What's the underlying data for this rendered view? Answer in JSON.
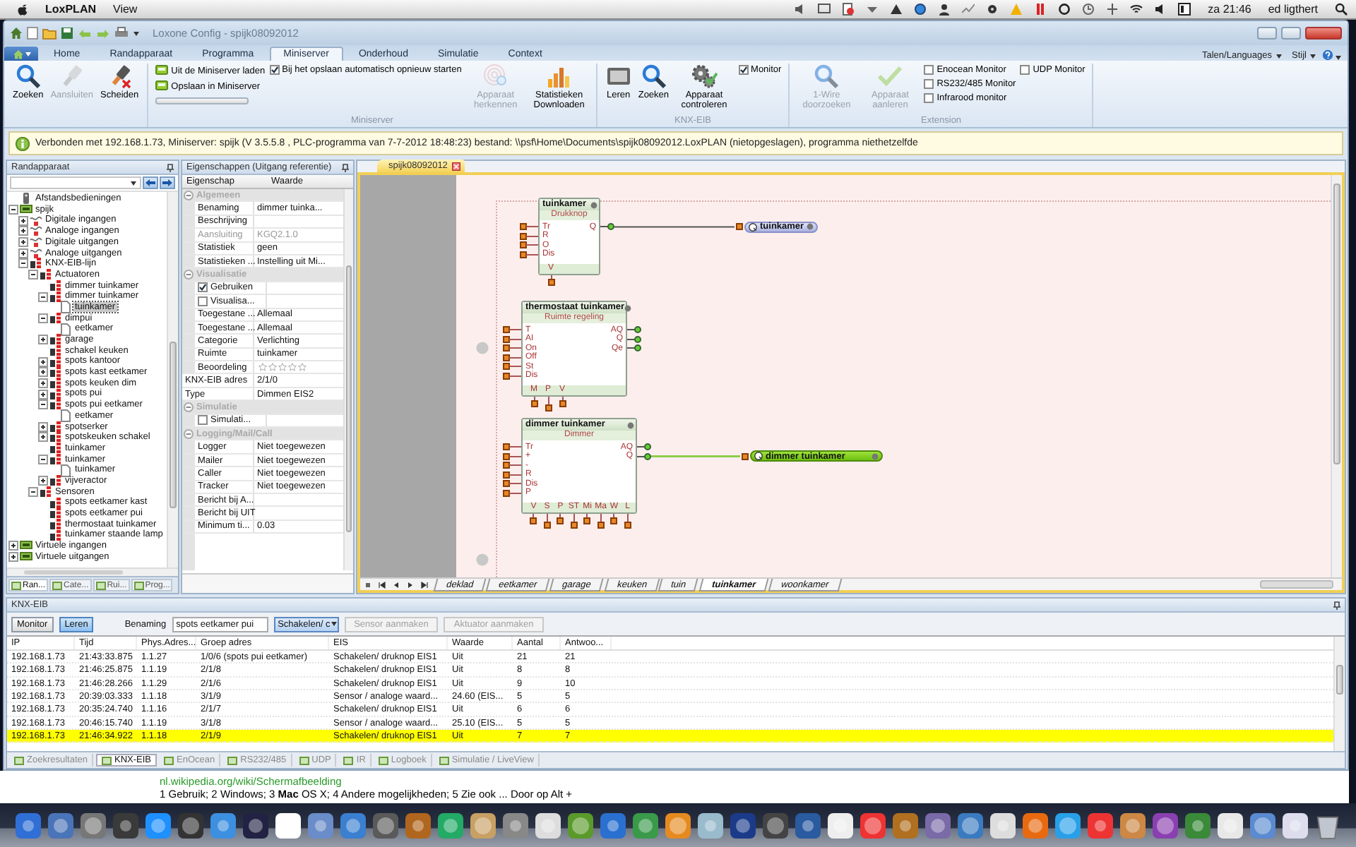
{
  "menubar": {
    "app": "LoxPLAN",
    "menus": [
      "View"
    ],
    "clock": "za 21:46",
    "user": "ed ligthert"
  },
  "window": {
    "title": "Loxone Config - spijk08092012"
  },
  "ribbon_tabs": [
    {
      "label": "Home",
      "selected": false
    },
    {
      "label": "Randapparaat",
      "selected": false
    },
    {
      "label": "Programma",
      "selected": false
    },
    {
      "label": "Miniserver",
      "selected": true
    },
    {
      "label": "Onderhoud",
      "selected": false
    },
    {
      "label": "Simulatie",
      "selected": false
    },
    {
      "label": "Context",
      "selected": false
    }
  ],
  "ribbon_links": [
    "Talen/Languages",
    "Stijl"
  ],
  "ribbon_groups": [
    {
      "items": [
        {
          "kind": "big",
          "label": "Zoeken",
          "disabled": false
        },
        {
          "kind": "big",
          "label": "Aansluiten",
          "disabled": true
        },
        {
          "kind": "big",
          "label": "Scheiden",
          "disabled": false
        }
      ]
    },
    {
      "label": "Miniserver",
      "items": [
        {
          "kind": "small",
          "label": "Uit de Miniserver laden"
        },
        {
          "kind": "small",
          "label": "Opslaan in Miniserver"
        },
        {
          "kind": "progress",
          "level": 0
        },
        {
          "kind": "check",
          "label": "Bij het opslaan automatisch opnieuw starten",
          "checked": true
        },
        {
          "kind": "big",
          "label": "Apparaat herkennen",
          "disabled": true
        },
        {
          "kind": "big",
          "label": "Statistieken Downloaden",
          "disabled": false
        }
      ]
    },
    {
      "label": "KNX-EIB",
      "items": [
        {
          "kind": "big",
          "label": "Leren",
          "disabled": false
        },
        {
          "kind": "big",
          "label": "Zoeken",
          "disabled": false
        },
        {
          "kind": "big",
          "label": "Apparaat controleren",
          "disabled": false
        },
        {
          "kind": "check",
          "label": "Monitor",
          "checked": true
        }
      ]
    },
    {
      "label": "Extension",
      "items": [
        {
          "kind": "big",
          "label": "1-Wire doorzoeken",
          "disabled": true
        },
        {
          "kind": "big",
          "label": "Apparaat aanleren",
          "disabled": true
        },
        {
          "kind": "check",
          "label": "Enocean Monitor",
          "checked": false
        },
        {
          "kind": "check",
          "label": "RS232/485 Monitor",
          "checked": false
        },
        {
          "kind": "check",
          "label": "Infrarood monitor",
          "checked": false
        },
        {
          "kind": "check",
          "label": "UDP Monitor",
          "checked": false
        }
      ]
    }
  ],
  "info_bar": {
    "text": "Verbonden met 192.168.1.73, Miniserver: spijk (V 3.5.5.8 , PLC-programma van 7-7-2012 18:48:23) bestand: \\\\psf\\Home\\Documents\\spijk08092012.LoxPLAN (nietopgeslagen), programma niethetzelfde"
  },
  "sidebar": {
    "title": "Randapparaat",
    "tree": [
      {
        "label": "Afstandsbedieningen",
        "kind": "remote",
        "selected": false
      },
      {
        "label": "spijk",
        "kind": "device",
        "selected": false,
        "expanded": true,
        "children": [
          {
            "label": "Digitale ingangen",
            "kind": "io",
            "selected": false,
            "expanded": false
          },
          {
            "label": "Analoge ingangen",
            "kind": "io",
            "selected": false,
            "expanded": false
          },
          {
            "label": "Digitale uitgangen",
            "kind": "io",
            "selected": false,
            "expanded": false
          },
          {
            "label": "Analoge uitgangen",
            "kind": "io",
            "selected": false,
            "expanded": false
          },
          {
            "label": "KNX-EIB-lijn",
            "kind": "module",
            "selected": false,
            "expanded": true,
            "children": [
              {
                "label": "Actuatoren",
                "kind": "module",
                "selected": false,
                "expanded": true,
                "children": [
                  {
                    "label": "dimmer tuinkamer",
                    "kind": "module",
                    "selected": false
                  },
                  {
                    "label": "dimmer tuinkamer",
                    "kind": "module",
                    "selected": false,
                    "expanded": true,
                    "children": [
                      {
                        "label": "tuinkamer",
                        "kind": "page",
                        "selected": true
                      }
                    ]
                  },
                  {
                    "label": "dimpui",
                    "kind": "module",
                    "selected": false,
                    "expanded": true,
                    "children": [
                      {
                        "label": "eetkamer",
                        "kind": "page",
                        "selected": false
                      }
                    ]
                  },
                  {
                    "label": "garage",
                    "kind": "module",
                    "selected": false,
                    "expanded": false
                  },
                  {
                    "label": "schakel keuken",
                    "kind": "module",
                    "selected": false
                  },
                  {
                    "label": "spots kantoor",
                    "kind": "module",
                    "selected": false,
                    "expanded": false
                  },
                  {
                    "label": "spots kast eetkamer",
                    "kind": "module",
                    "selected": false,
                    "expanded": false
                  },
                  {
                    "label": "spots keuken dim",
                    "kind": "module",
                    "selected": false,
                    "expanded": false
                  },
                  {
                    "label": "spots pui",
                    "kind": "module",
                    "selected": false,
                    "expanded": false
                  },
                  {
                    "label": "spots pui eetkamer",
                    "kind": "module",
                    "selected": false,
                    "expanded": true,
                    "children": [
                      {
                        "label": "eetkamer",
                        "kind": "page",
                        "selected": false
                      }
                    ]
                  },
                  {
                    "label": "spotserker",
                    "kind": "module",
                    "selected": false,
                    "expanded": false
                  },
                  {
                    "label": "spotskeuken schakel",
                    "kind": "module",
                    "selected": false,
                    "expanded": false
                  },
                  {
                    "label": "tuinkamer",
                    "kind": "module",
                    "selected": false
                  },
                  {
                    "label": "tuinkamer",
                    "kind": "module",
                    "selected": false,
                    "expanded": true,
                    "children": [
                      {
                        "label": "tuinkamer",
                        "kind": "page",
                        "selected": false
                      }
                    ]
                  },
                  {
                    "label": "vijveractor",
                    "kind": "module",
                    "selected": false,
                    "expanded": false
                  }
                ]
              },
              {
                "label": "Sensoren",
                "kind": "module",
                "selected": false,
                "expanded": true,
                "children": [
                  {
                    "label": "spots eetkamer kast",
                    "kind": "module",
                    "selected": false
                  },
                  {
                    "label": "spots eetkamer pui",
                    "kind": "module",
                    "selected": false
                  },
                  {
                    "label": "thermostaat tuinkamer",
                    "kind": "module",
                    "selected": false
                  },
                  {
                    "label": "tuinkamer staande lamp",
                    "kind": "module",
                    "selected": false
                  }
                ]
              }
            ]
          }
        ]
      },
      {
        "label": "Virtuele ingangen",
        "kind": "device",
        "selected": false,
        "expanded": false
      },
      {
        "label": "Virtuele uitgangen",
        "kind": "device",
        "selected": false,
        "expanded": false
      }
    ],
    "tabs": [
      {
        "label": "Ran...",
        "selected": true
      },
      {
        "label": "Cate...",
        "selected": false
      },
      {
        "label": "Rui...",
        "selected": false
      },
      {
        "label": "Prog...",
        "selected": false
      }
    ]
  },
  "properties": {
    "title": "Eigenschappen (Uitgang referentie)",
    "columns": [
      "Eigenschap",
      "Waarde"
    ],
    "rows": [
      {
        "kind": "section",
        "label": "Algemeen"
      },
      {
        "kind": "row",
        "label": "Benaming",
        "value": "dimmer tuinka...",
        "disabled": false
      },
      {
        "kind": "row",
        "label": "Beschrijving",
        "disabled": false
      },
      {
        "kind": "row",
        "label": "Aansluiting",
        "value": "KGQ2.1.0",
        "disabled": true
      },
      {
        "kind": "row",
        "label": "Statistiek",
        "value": "geen",
        "disabled": false
      },
      {
        "kind": "row",
        "label": "Statistieken ...",
        "value": "Instelling uit Mi...",
        "disabled": false
      },
      {
        "kind": "section",
        "label": "Visualisatie"
      },
      {
        "kind": "check",
        "label": "Gebruiken",
        "checked": true
      },
      {
        "kind": "check",
        "label": "Visualisa...",
        "checked": false
      },
      {
        "kind": "row",
        "label": "Toegestane ...",
        "value": "Allemaal",
        "disabled": false
      },
      {
        "kind": "row",
        "label": "Toegestane ...",
        "value": "Allemaal",
        "disabled": false
      },
      {
        "kind": "row",
        "label": "Categorie",
        "value": "Verlichting",
        "disabled": false
      },
      {
        "kind": "row",
        "label": "Ruimte",
        "value": "tuinkamer",
        "disabled": false
      },
      {
        "kind": "stars",
        "label": "Beoordeling",
        "stars": 0
      },
      {
        "kind": "top",
        "label": "KNX-EIB adres",
        "value": "2/1/0"
      },
      {
        "kind": "top",
        "label": "Type",
        "value": "Dimmen EIS2"
      },
      {
        "kind": "section",
        "label": "Simulatie"
      },
      {
        "kind": "check",
        "label": "Simulati...",
        "checked": false
      },
      {
        "kind": "section",
        "label": "Logging/Mail/Call"
      },
      {
        "kind": "row",
        "label": "Logger",
        "value": "Niet toegewezen",
        "disabled": false
      },
      {
        "kind": "row",
        "label": "Mailer",
        "value": "Niet toegewezen",
        "disabled": false
      },
      {
        "kind": "row",
        "label": "Caller",
        "value": "Niet toegewezen",
        "disabled": false
      },
      {
        "kind": "row",
        "label": "Tracker",
        "value": "Niet toegewezen",
        "disabled": false
      },
      {
        "kind": "row",
        "label": "Bericht bij A...",
        "disabled": false
      },
      {
        "kind": "row",
        "label": "Bericht bij UIT",
        "disabled": false
      },
      {
        "kind": "row",
        "label": "Minimum ti...",
        "value": "0.03",
        "disabled": false
      }
    ]
  },
  "editor": {
    "document_tab": "spijk08092012",
    "blocks": [
      {
        "title": "tuinkamer",
        "type": "Drukknop",
        "inputs": [
          "Tr",
          "R",
          "O",
          "Dis"
        ],
        "outputs": [
          "Q"
        ],
        "params": [
          "V"
        ]
      },
      {
        "title": "thermostaat tuinkamer",
        "type": "Ruimte regeling",
        "inputs": [
          "T",
          "AI",
          "On",
          "Off",
          "St",
          "Dis"
        ],
        "outputs": [
          "AQ",
          "Q",
          "Qe"
        ],
        "params": [
          "M",
          "P",
          "V"
        ]
      },
      {
        "title": "dimmer tuinkamer",
        "type": "Dimmer",
        "inputs": [
          "Tr",
          "+",
          "-",
          "R",
          "Dis",
          "P"
        ],
        "outputs": [
          "AQ",
          "Q"
        ],
        "params": [
          "V",
          "S",
          "P",
          "ST",
          "Mi",
          "Ma",
          "W",
          "L"
        ]
      }
    ],
    "outputs": [
      {
        "label": "tuinkamer",
        "active": false
      },
      {
        "label": "dimmer tuinkamer",
        "active": true
      }
    ],
    "pages": [
      {
        "label": "deklad",
        "selected": false
      },
      {
        "label": "eetkamer",
        "selected": false
      },
      {
        "label": "garage",
        "selected": false
      },
      {
        "label": "keuken",
        "selected": false
      },
      {
        "label": "tuin",
        "selected": false
      },
      {
        "label": "tuinkamer",
        "selected": true
      },
      {
        "label": "woonkamer",
        "selected": false
      }
    ]
  },
  "knx_panel": {
    "title": "KNX-EIB",
    "modes": [
      {
        "label": "Monitor",
        "selected": false
      },
      {
        "label": "Leren",
        "selected": true
      }
    ],
    "name_label": "Benaming",
    "name_value": "spots eetkamer pui",
    "type_value": "Schakelen/ c",
    "actions": [
      {
        "label": "Sensor aanmaken",
        "disabled": true
      },
      {
        "label": "Aktuator aanmaken",
        "disabled": true
      }
    ],
    "table": {
      "columns": [
        "IP",
        "Tijd",
        "Phys.Adres...",
        "Groep adres",
        "EIS",
        "Waarde",
        "Aantal",
        "Antwoo..."
      ],
      "rows": [
        {
          "cells": [
            "192.168.1.73",
            "21:43:33.875",
            "1.1.27",
            "1/0/6 (spots pui eetkamer)",
            "Schakelen/ druknop EIS1",
            "Uit",
            "21",
            "21"
          ],
          "selected": false
        },
        {
          "cells": [
            "192.168.1.73",
            "21:46:25.875",
            "1.1.19",
            "2/1/8",
            "Schakelen/ druknop EIS1",
            "Uit",
            "8",
            "8"
          ],
          "selected": false
        },
        {
          "cells": [
            "192.168.1.73",
            "21:46:28.266",
            "1.1.29",
            "2/1/6",
            "Schakelen/ druknop EIS1",
            "Uit",
            "9",
            "10"
          ],
          "selected": false
        },
        {
          "cells": [
            "192.168.1.73",
            "20:39:03.333",
            "1.1.18",
            "3/1/9",
            "Sensor / analoge waard...",
            "24.60 (EIS...",
            "5",
            "5"
          ],
          "selected": false
        },
        {
          "cells": [
            "192.168.1.73",
            "20:35:24.740",
            "1.1.16",
            "2/1/7",
            "Schakelen/ druknop EIS1",
            "Uit",
            "6",
            "6"
          ],
          "selected": false
        },
        {
          "cells": [
            "192.168.1.73",
            "20:46:15.740",
            "1.1.19",
            "3/1/8",
            "Sensor / analoge waard...",
            "25.10 (EIS...",
            "5",
            "5"
          ],
          "selected": false
        },
        {
          "cells": [
            "192.168.1.73",
            "21:46:34.922",
            "1.1.18",
            "2/1/9",
            "Schakelen/ druknop EIS1",
            "Uit",
            "7",
            "7"
          ],
          "selected": true
        }
      ]
    },
    "tabs": [
      {
        "label": "Zoekresultaten",
        "selected": false
      },
      {
        "label": "KNX-EIB",
        "selected": true
      },
      {
        "label": "EnOcean",
        "selected": false
      },
      {
        "label": "RS232/485",
        "selected": false
      },
      {
        "label": "UDP",
        "selected": false
      },
      {
        "label": "IR",
        "selected": false
      },
      {
        "label": "Logboek",
        "selected": false
      },
      {
        "label": "Simulatie / LiveView",
        "selected": false
      }
    ]
  },
  "web_result": {
    "url": "nl.wikipedia.org/wiki/Schermafbeelding",
    "snippet": "1 Gebruik; 2 Windows; 3 **Mac** OS X; 4 Andere mogelijkheden; 5 Zie ook ... Door op Alt +"
  }
}
